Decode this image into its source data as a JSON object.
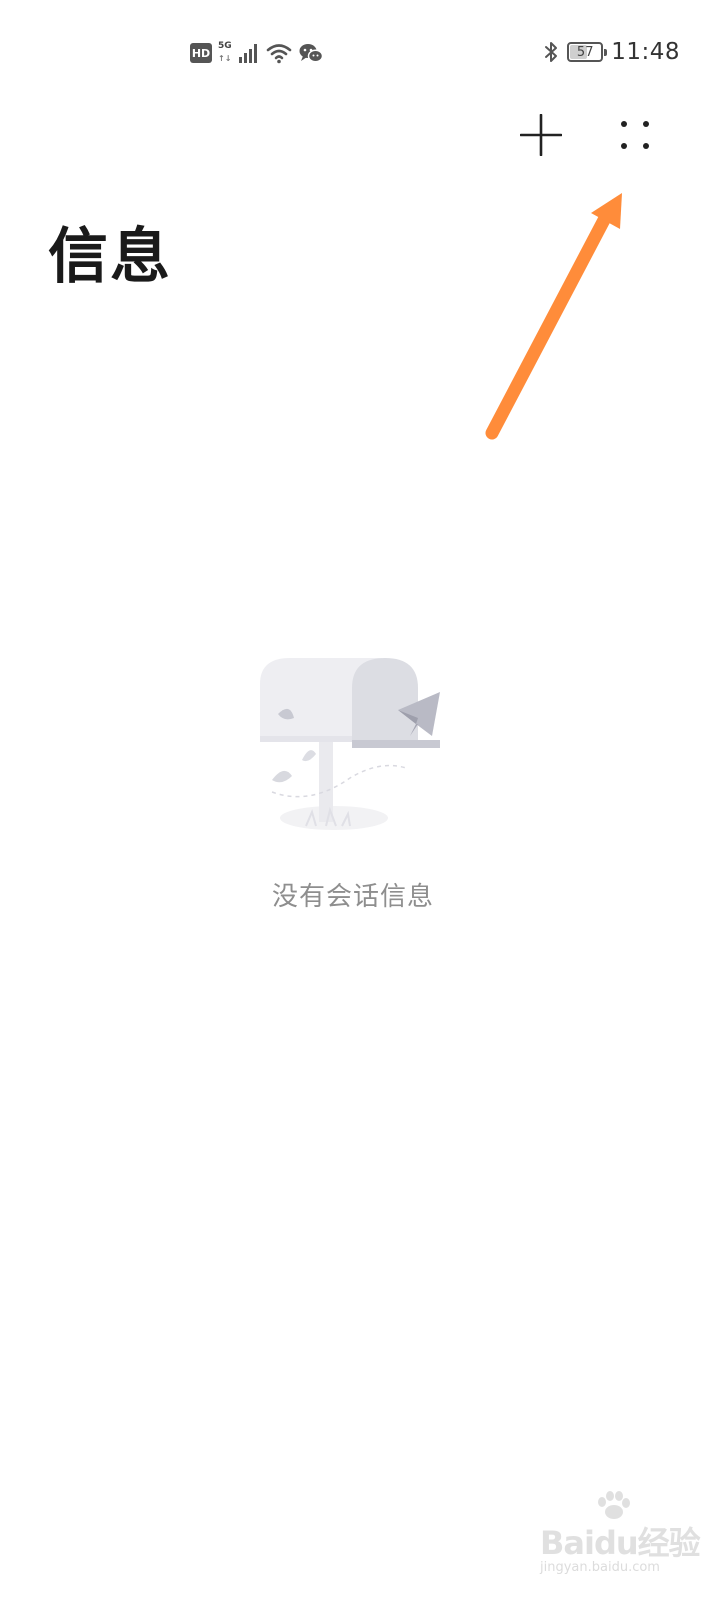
{
  "status_bar": {
    "hd": "HD",
    "network": "5G",
    "data_arrows": "↑↓",
    "battery_level": "57",
    "battery_fraction": 0.57,
    "time": "11:48",
    "icons": [
      "hd-icon",
      "5g-icon",
      "signal-icon",
      "wifi-icon",
      "wechat-icon",
      "bluetooth-icon",
      "battery-icon"
    ]
  },
  "toolbar": {
    "add_icon": "plus-icon",
    "more_icon": "more-dots-icon"
  },
  "header": {
    "title": "信息"
  },
  "empty_state": {
    "illustration": "mailbox-icon",
    "message": "没有会话信息"
  },
  "annotation": {
    "arrow_color": "#FF8C3A"
  },
  "watermark": {
    "logo": "Baidu经验",
    "url": "jingyan.baidu.com"
  }
}
